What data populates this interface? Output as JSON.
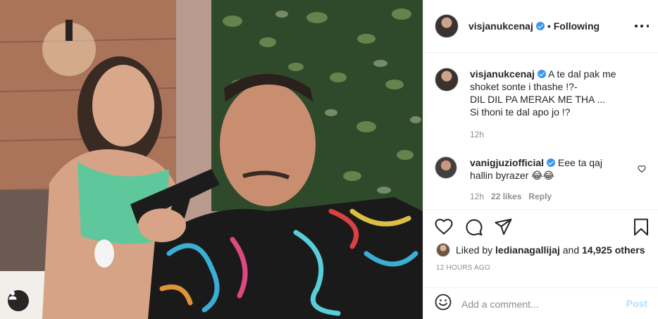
{
  "post": {
    "author": "visjanukcenaj",
    "follow_state": "Following",
    "separator": "•"
  },
  "caption": {
    "author": "visjanukcenaj",
    "text": "A te dal pak me shoket sonte i thashe !?-\nDIL DIL PA MERAK ME THA ...\nSi thoni te dal apo jo !?",
    "time": "12h"
  },
  "comments": [
    {
      "author": "vanigjuziofficial",
      "text": "Eee ta qaj hallin byrazer 😂😂",
      "time": "12h",
      "likes": "22 likes",
      "reply_label": "Reply"
    }
  ],
  "likes": {
    "prefix": "Liked by",
    "first_user": "ledianagallijaj",
    "conjunction": "and",
    "others": "14,925 others"
  },
  "timestamp": "12 HOURS AGO",
  "add_comment": {
    "placeholder": "Add a comment...",
    "post_label": "Post"
  },
  "colors": {
    "verified": "#3897f0",
    "post_disabled": "#b2dffc",
    "muted": "#8e8e8e"
  },
  "icons": [
    "user-tag-icon",
    "more-options-icon",
    "verified-icon",
    "heart-icon",
    "comment-icon",
    "share-icon",
    "bookmark-icon",
    "emoji-icon"
  ]
}
